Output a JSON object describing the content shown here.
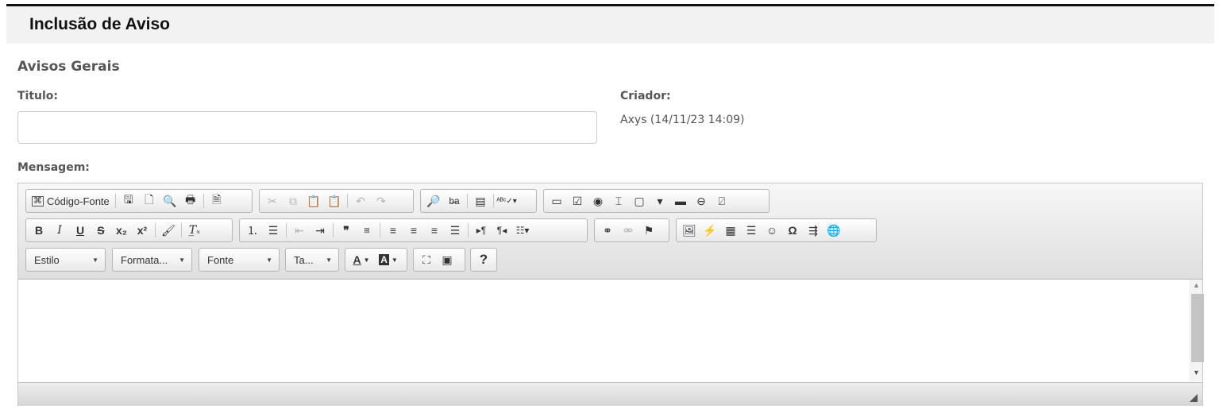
{
  "header": {
    "title": "Inclusão de Aviso"
  },
  "section": {
    "title": "Avisos Gerais"
  },
  "form": {
    "titulo_label": "Titulo:",
    "titulo_value": "",
    "criador_label": "Criador:",
    "criador_value": "Axys (14/11/23 14:09)",
    "mensagem_label": "Mensagem:"
  },
  "editor": {
    "source_label": "Código-Fonte",
    "combos": {
      "style": "Estilo",
      "format": "Formata...",
      "font": "Fonte",
      "size": "Ta..."
    },
    "help_label": "?",
    "icons": [
      "source-icon",
      "save-icon",
      "new-page-icon",
      "preview-icon",
      "print-icon",
      "templates-icon",
      "cut-icon",
      "copy-icon",
      "paste-icon",
      "paste-text-icon",
      "undo-icon",
      "redo-icon",
      "find-icon",
      "replace-icon",
      "select-all-icon",
      "spellcheck-icon",
      "form-icon",
      "checkbox-icon",
      "radio-icon",
      "textfield-icon",
      "textarea-icon",
      "select-icon",
      "button-icon",
      "image-button-icon",
      "hidden-field-icon",
      "bold-icon",
      "italic-icon",
      "underline-icon",
      "strike-icon",
      "subscript-icon",
      "superscript-icon",
      "copy-format-icon",
      "remove-format-icon",
      "numbered-list-icon",
      "bulleted-list-icon",
      "outdent-icon",
      "indent-icon",
      "blockquote-icon",
      "div-icon",
      "align-left-icon",
      "align-center-icon",
      "align-right-icon",
      "justify-icon",
      "ltr-icon",
      "rtl-icon",
      "language-icon",
      "link-icon",
      "unlink-icon",
      "anchor-icon",
      "image-icon",
      "flash-icon",
      "table-icon",
      "horizontal-rule-icon",
      "smiley-icon",
      "special-char-icon",
      "page-break-icon",
      "iframe-icon",
      "text-color-icon",
      "bg-color-icon",
      "maximize-icon",
      "show-blocks-icon",
      "help-icon"
    ]
  }
}
